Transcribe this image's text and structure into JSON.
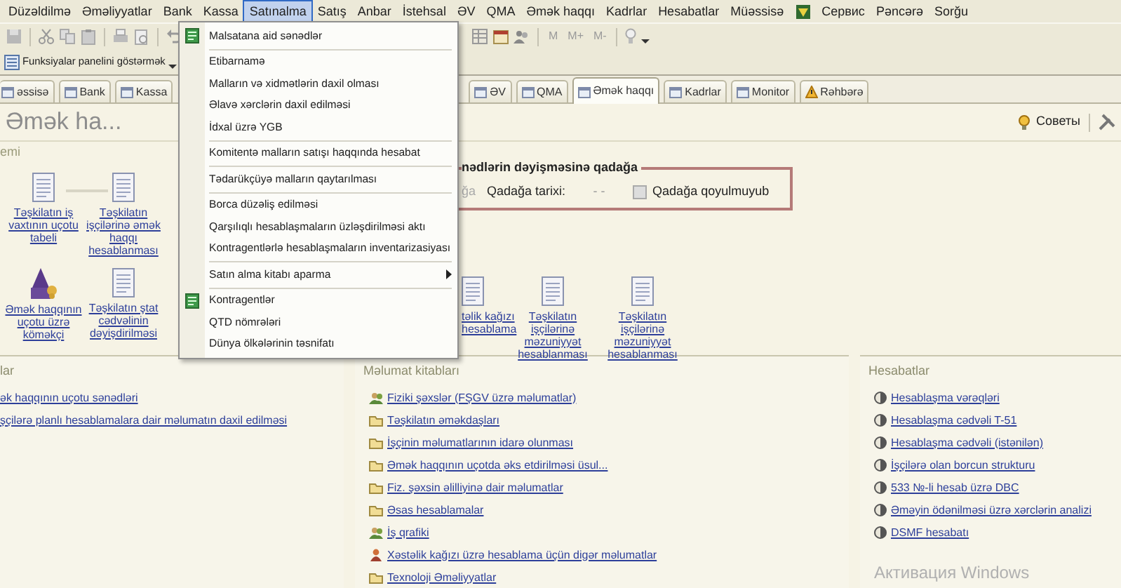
{
  "menu_bar": {
    "items": [
      {
        "kind": "text",
        "label": "Düzəldilmə",
        "selected": false
      },
      {
        "kind": "text",
        "label": "Əməliyyatlar",
        "selected": false
      },
      {
        "kind": "text",
        "label": "Bank",
        "selected": false
      },
      {
        "kind": "text",
        "label": "Kassa",
        "selected": false
      },
      {
        "kind": "text",
        "label": "Satınalma",
        "selected": true
      },
      {
        "kind": "text",
        "label": "Satış",
        "selected": false
      },
      {
        "kind": "text",
        "label": "Anbar",
        "selected": false
      },
      {
        "kind": "text",
        "label": "İstehsal",
        "selected": false
      },
      {
        "kind": "text",
        "label": "ƏV",
        "selected": false
      },
      {
        "kind": "text",
        "label": "QMA",
        "selected": false
      },
      {
        "kind": "text",
        "label": "Əmək haqqı",
        "selected": false
      },
      {
        "kind": "text",
        "label": "Kadrlar",
        "selected": false
      },
      {
        "kind": "text",
        "label": "Hesabatlar",
        "selected": false
      },
      {
        "kind": "text",
        "label": "Müəssisə",
        "selected": false
      },
      {
        "kind": "icon",
        "selected": false
      },
      {
        "kind": "text",
        "label": "Сервис",
        "selected": false
      },
      {
        "kind": "text",
        "label": "Pəncərə",
        "selected": false
      },
      {
        "kind": "text",
        "label": "Sorğu",
        "selected": false
      }
    ]
  },
  "toolbar": {
    "memory_buttons": [
      "M",
      "M+",
      "M-"
    ]
  },
  "functions_toolbar": {
    "label": "Funksiyalar panelini göstərmək"
  },
  "tabs": [
    {
      "label": "əssisə",
      "kind": "plain",
      "selected": false
    },
    {
      "label": "Bank",
      "kind": "plain",
      "selected": false
    },
    {
      "label": "Kassa",
      "kind": "plain",
      "selected": false
    },
    {
      "label": "ƏV",
      "kind": "plain",
      "selected": false
    },
    {
      "label": "QMA",
      "kind": "plain",
      "selected": false
    },
    {
      "label": "Əmək haqqı",
      "kind": "plain",
      "selected": true
    },
    {
      "label": "Kadrlar",
      "kind": "plain",
      "selected": false
    },
    {
      "label": "Monitor",
      "kind": "plain",
      "selected": false
    },
    {
      "label": "Rəhbərə",
      "kind": "warning",
      "selected": false
    }
  ],
  "page": {
    "title": "Əmək ha...",
    "hints": "Советы"
  },
  "scheme_panel": {
    "title": "emi",
    "nodes": [
      {
        "kind": "document",
        "label": "Təşkilatın iş vaxtının uçotu tabeli"
      },
      {
        "kind": "document",
        "label": "Təşkilatın işçilərinə əmək haqqı hesablanması"
      },
      {
        "kind": "wizard",
        "label": "Əmək haqqının uçotu üzrə köməkçi"
      },
      {
        "kind": "document",
        "label": "Təşkilatın ştat cədvəlinin dəyişdirilməsi"
      },
      {
        "kind": "document",
        "label": "təlik kağızı hesablama"
      },
      {
        "kind": "document",
        "label": "Təşkilatın işçilərinə məzuniyyət hesablanması"
      },
      {
        "kind": "document",
        "label": "Təşkilatın işçilərinə məzuniyyət hesablanması"
      }
    ],
    "lock_box": {
      "title": "nədlərin dəyişməsinə qadağa",
      "cut_label": "ğa",
      "date_label": "Qadağa tarixi:",
      "date_value": "- -",
      "status": "Qadağa qoyulmuyub"
    }
  },
  "sections": [
    {
      "title": "lar",
      "links": [
        {
          "kind": "none",
          "label": "ək haqqının uçotu sənədləri"
        },
        {
          "kind": "none",
          "label": "şçilərə planlı hesablamalara dair məlumatın daxil edilməsi"
        }
      ]
    },
    {
      "title": "Məlumat kitabları",
      "links": [
        {
          "kind": "people",
          "label": "Fiziki şəxslər (FŞGV üzrə məlumatlar)"
        },
        {
          "kind": "folder",
          "label": "Təşkilatın əməkdaşları"
        },
        {
          "kind": "folder",
          "label": "İşçinin məlumatlarının idarə olunması"
        },
        {
          "kind": "folder",
          "label": "Əmək haqqının uçotda əks etdirilməsi üsul..."
        },
        {
          "kind": "folder",
          "label": "Fiz. şəxsin əlilliyinə dair məlumatlar"
        },
        {
          "kind": "folder",
          "label": "Əsas hesablamalar"
        },
        {
          "kind": "people",
          "label": "İş qrafiki"
        },
        {
          "kind": "person",
          "label": "Xəstəlik kağızı üzrə hesablama üçün digər məlumatlar"
        },
        {
          "kind": "folder",
          "label": "Texnoloji Əməliyyatlar"
        }
      ]
    },
    {
      "title": "Hesabatlar",
      "links": [
        {
          "kind": "report",
          "label": "Hesablaşma vərəqləri"
        },
        {
          "kind": "report",
          "label": "Hesablaşma cədvəli T-51"
        },
        {
          "kind": "report",
          "label": "Hesablaşma cədvəli (istənilən)"
        },
        {
          "kind": "report",
          "label": "İşçilərə olan borcun strukturu"
        },
        {
          "kind": "report",
          "label": "533 №-li hesab üzrə DBC"
        },
        {
          "kind": "report",
          "label": "Əməyin ödənilməsi üzrə xərclərin analizi"
        },
        {
          "kind": "report",
          "label": "DSMF hesabatı"
        }
      ]
    }
  ],
  "os_notice": "Активация Windows",
  "dropdown": {
    "items": [
      {
        "kind": "icon-item",
        "label": "Malsatana aid sənədlər",
        "submenu": false
      },
      {
        "kind": "separator"
      },
      {
        "kind": "item",
        "label": "Etibarnamə",
        "submenu": false
      },
      {
        "kind": "item",
        "label": "Malların və xidmətlərin daxil olması",
        "submenu": false
      },
      {
        "kind": "item",
        "label": "Əlavə xərclərin daxil edilməsi",
        "submenu": false
      },
      {
        "kind": "item",
        "label": "İdxal üzrə YGB",
        "submenu": false
      },
      {
        "kind": "separator"
      },
      {
        "kind": "item",
        "label": "Komitentə malların satışı haqqında hesabat",
        "submenu": false
      },
      {
        "kind": "separator"
      },
      {
        "kind": "item",
        "label": "Tədarükçüyə malların qaytarılması",
        "submenu": false
      },
      {
        "kind": "separator"
      },
      {
        "kind": "item",
        "label": "Borca düzəliş edilməsi",
        "submenu": false
      },
      {
        "kind": "item",
        "label": "Qarşılıqlı hesablaşmaların üzləşdirilməsi aktı",
        "submenu": false
      },
      {
        "kind": "item",
        "label": "Kontragentlərlə hesablaşmaların inventarizasiyası",
        "submenu": false
      },
      {
        "kind": "separator"
      },
      {
        "kind": "item",
        "label": "Satın alma kitabı aparma",
        "submenu": true
      },
      {
        "kind": "separator"
      },
      {
        "kind": "icon-item",
        "label": "Kontragentlər",
        "submenu": false
      },
      {
        "kind": "item",
        "label": "QTD nömrələri",
        "submenu": false
      },
      {
        "kind": "item",
        "label": "Dünya ölkələrinin təsnifatı",
        "submenu": false
      }
    ]
  }
}
